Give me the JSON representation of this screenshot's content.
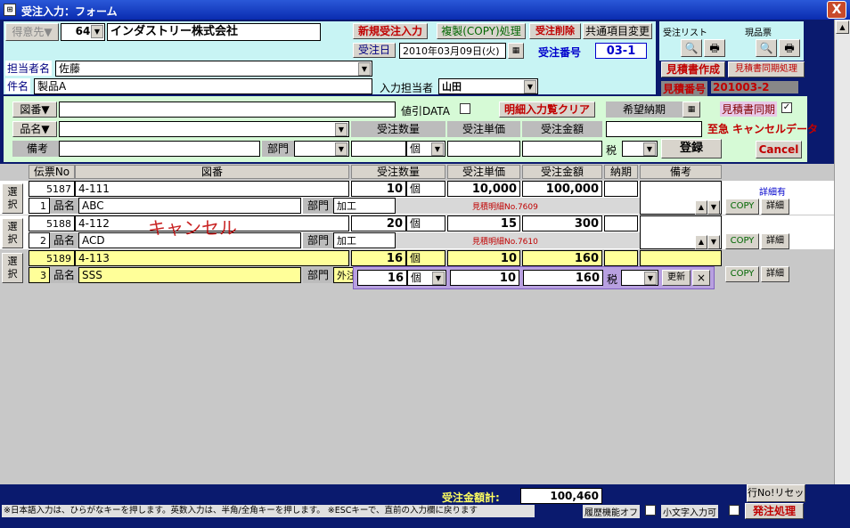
{
  "window": {
    "title": "受注入力：フォーム",
    "close": "X"
  },
  "header": {
    "customer_btn": "得意先▼",
    "customer_code": "64",
    "customer_name": "インダストリー株式会社",
    "new_order": "新規受注入力",
    "copy_process": "複製(COPY)処理",
    "delete_order": "受注削除",
    "common_change": "共通項目変更",
    "order_date_label": "受注日",
    "order_date": "2010年03月09日(火)",
    "order_no_label": "受注番号",
    "order_no": "03-1",
    "person_label": "担当者名",
    "person": "佐藤",
    "subject_label": "件名",
    "subject": "製品A",
    "input_person_label": "入力担当者",
    "input_person": "山田"
  },
  "right_panel": {
    "order_list": "受注リスト",
    "current_ticket": "現品票",
    "estimate_create": "見積書作成",
    "estimate_sync": "見積書同期処理",
    "estimate_no_label": "見積番号",
    "estimate_no": "201003-2"
  },
  "entry": {
    "drawing_btn": "図番▼",
    "price_data": "値引DATA",
    "detail_clear": "明細入力覧クリア",
    "desired_delivery": "希望納期",
    "estimate_sync_chk": "見積書同期",
    "product_btn": "品名▼",
    "qty_h": "受注数量",
    "unit_price_h": "受注単価",
    "amount_h": "受注金額",
    "urgent": "至急",
    "cancel_data": "キャンセルデータ",
    "remarks": "備考",
    "dept": "部門",
    "unit": "個",
    "tax": "税",
    "register": "登録",
    "cancel": "Cancel"
  },
  "table": {
    "headers": {
      "slip": "伝票No",
      "drawing": "図番",
      "qty": "受注数量",
      "price": "受注単価",
      "amount": "受注金額",
      "delivery": "納期",
      "remarks": "備考"
    },
    "select_label_1": "選",
    "select_label_2": "択",
    "name_label": "品名",
    "dept_label": "部門",
    "detail_flag": "詳細有",
    "copy_btn": "COPY",
    "detail_btn": "詳細",
    "cancel_overlay": "キャンセル",
    "rows": [
      {
        "slip": "5187",
        "line": "1",
        "drawing": "4-111",
        "name": "ABC",
        "dept": "加工",
        "qty": "10",
        "unit": "個",
        "price": "10,000",
        "amount": "100,000",
        "est_ref": "見積明細No.7609"
      },
      {
        "slip": "5188",
        "line": "2",
        "drawing": "4-112",
        "name": "ACD",
        "dept": "加工",
        "qty": "20",
        "unit": "個",
        "price": "15",
        "amount": "300",
        "est_ref": "見積明細No.7610"
      },
      {
        "slip": "5189",
        "line": "3",
        "drawing": "4-113",
        "name": "SSS",
        "dept": "外注",
        "qty": "16",
        "unit": "個",
        "price": "10",
        "amount": "160",
        "est_ref": ""
      }
    ],
    "edit": {
      "qty": "16",
      "unit": "個",
      "price": "10",
      "amount": "160",
      "tax": "税",
      "update": "更新",
      "close": "×"
    }
  },
  "footer": {
    "total_label": "受注金額計:",
    "total": "100,460",
    "row_reset": "行No!リセット",
    "hint": "※日本語入力は、ひらがなキーを押します。英数入力は、半角/全角キーを押します。 ※ESCキーで、直前の入力欄に戻ります",
    "history_off": "履歴機能オフ",
    "lowercase": "小文字入力可",
    "order_process": "発注処理"
  },
  "colors": {
    "bg": "#0a1a6e",
    "header_cyan": "#c8f4f4",
    "entry_green": "#d6fad6",
    "row_yellow": "#ffff99",
    "accent_red": "#c00000"
  }
}
